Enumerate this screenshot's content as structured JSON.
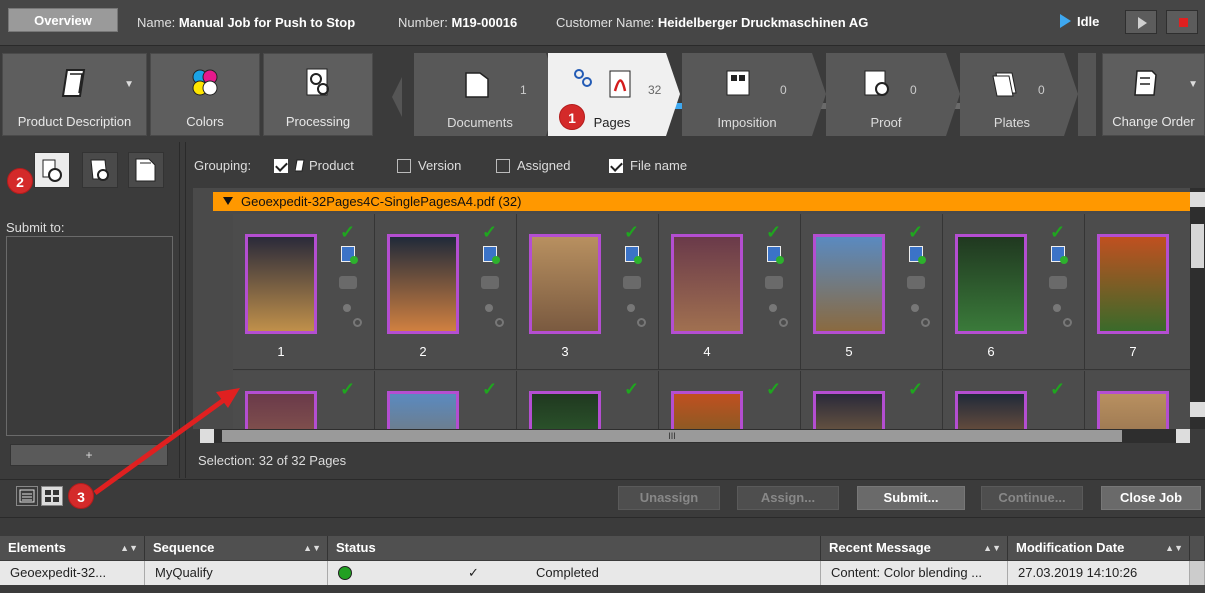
{
  "header": {
    "overview": "Overview",
    "name_label": "Name:",
    "name_value": "Manual Job for Push to Stop",
    "number_label": "Number:",
    "number_value": "M19-00016",
    "customer_label": "Customer Name:",
    "customer_value": "Heidelberger Druckmaschinen AG",
    "state": "Idle"
  },
  "tiles": {
    "product": "Product Description",
    "colors": "Colors",
    "processing": "Processing",
    "change_order": "Change Order"
  },
  "steps": [
    {
      "label": "Documents",
      "count": "1"
    },
    {
      "label": "Pages",
      "count": "32"
    },
    {
      "label": "Imposition",
      "count": "0"
    },
    {
      "label": "Proof",
      "count": "0"
    },
    {
      "label": "Plates",
      "count": "0"
    }
  ],
  "progress": 0.45,
  "left": {
    "submit_to": "Submit to:",
    "plus": "+"
  },
  "grouping": {
    "label": "Grouping:",
    "product": "Product",
    "version": "Version",
    "assigned": "Assigned",
    "file_name": "File name",
    "product_checked": true,
    "version_checked": false,
    "assigned_checked": false,
    "file_name_checked": true
  },
  "group_title": "Geoexpedit-32Pages4C-SinglePagesA4.pdf (32)",
  "pages": [
    "1",
    "2",
    "3",
    "4",
    "5",
    "6",
    "7"
  ],
  "selection": "Selection:  32 of 32 Pages",
  "actions": {
    "unassign": "Unassign",
    "assign": "Assign...",
    "submit": "Submit...",
    "continue": "Continue...",
    "close": "Close Job"
  },
  "table": {
    "headers": [
      "Elements",
      "Sequence",
      "Status",
      "Recent Message",
      "Modification Date"
    ],
    "row": {
      "element": "Geoexpedit-32...",
      "sequence": "MyQualify",
      "check": "✓",
      "status": "Completed",
      "message": "Content: Color blending ...",
      "date": "27.03.2019 14:10:26"
    }
  },
  "markers": [
    "1",
    "2",
    "3"
  ],
  "colors": {
    "accent": "#3ea8f0",
    "orange": "#ff9800",
    "marker": "#d42a2a",
    "check": "#1fa61f"
  }
}
